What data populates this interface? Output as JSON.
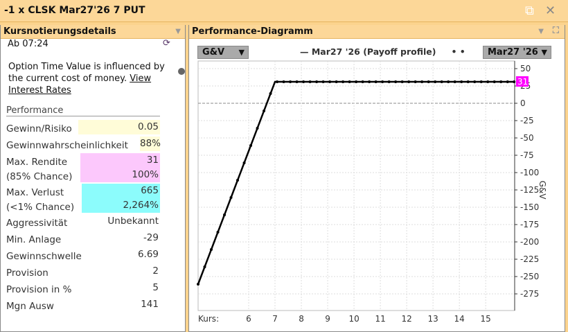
{
  "window": {
    "title": "-1 x CLSK Mar27'26 7 PUT"
  },
  "left": {
    "title": "Kursnotierungsdetails",
    "time": "Ab 07:24",
    "note": "Option Time Value is influenced by the current cost of money.",
    "link": "View Interest Rates",
    "section": "Performance",
    "rows": [
      {
        "label": "Gewinn/Risiko",
        "value": "0.05",
        "bg": "#fffcd8"
      },
      {
        "label": "Gewinnwahrscheinlichkeit",
        "value": "88%",
        "bg": "#fffcd8"
      },
      {
        "label": "Max. Rendite",
        "label2": "(85% Chance)",
        "value": "31",
        "value2": "100%",
        "bg": "#fcc8fc"
      },
      {
        "label": "Max. Verlust",
        "label2": "(<1% Chance)",
        "value": "665",
        "value2": "2,264%",
        "bg": "#8cfcfc"
      },
      {
        "label": "Aggressivität",
        "value": "Unbekannt"
      },
      {
        "label": "Min. Anlage",
        "value": "-29"
      },
      {
        "label": "Gewinnschwelle",
        "value": "6.69"
      },
      {
        "label": "Provision",
        "value": "2"
      },
      {
        "label": "Provision in %",
        "value": "5"
      },
      {
        "label": "Mgn Ausw",
        "value": "141"
      }
    ]
  },
  "right": {
    "title": "Performance-Diagramm",
    "metric_select": "G&V",
    "legend": "Mar27 '26 (Payoff profile)",
    "date_select": "Mar27 '26",
    "xaxis_label": "Kurs:"
  },
  "chart_data": {
    "type": "line",
    "ylabel": "G&V",
    "xlim": [
      4.08,
      16.1
    ],
    "ylim": [
      -299,
      61
    ],
    "xticks": [
      6,
      7,
      8,
      9,
      10,
      11,
      12,
      13,
      14,
      15
    ],
    "yticks": [
      50,
      25,
      0,
      -25,
      -50,
      -75,
      -100,
      -125,
      -150,
      -175,
      -200,
      -225,
      -250,
      -275
    ],
    "series": [
      {
        "name": "Mar27 '26 (Payoff profile)",
        "points": [
          [
            4.08,
            -261
          ],
          [
            7,
            31
          ],
          [
            16.1,
            31
          ]
        ]
      }
    ],
    "marker_value": "31",
    "marker_color": "#ff00ff"
  }
}
